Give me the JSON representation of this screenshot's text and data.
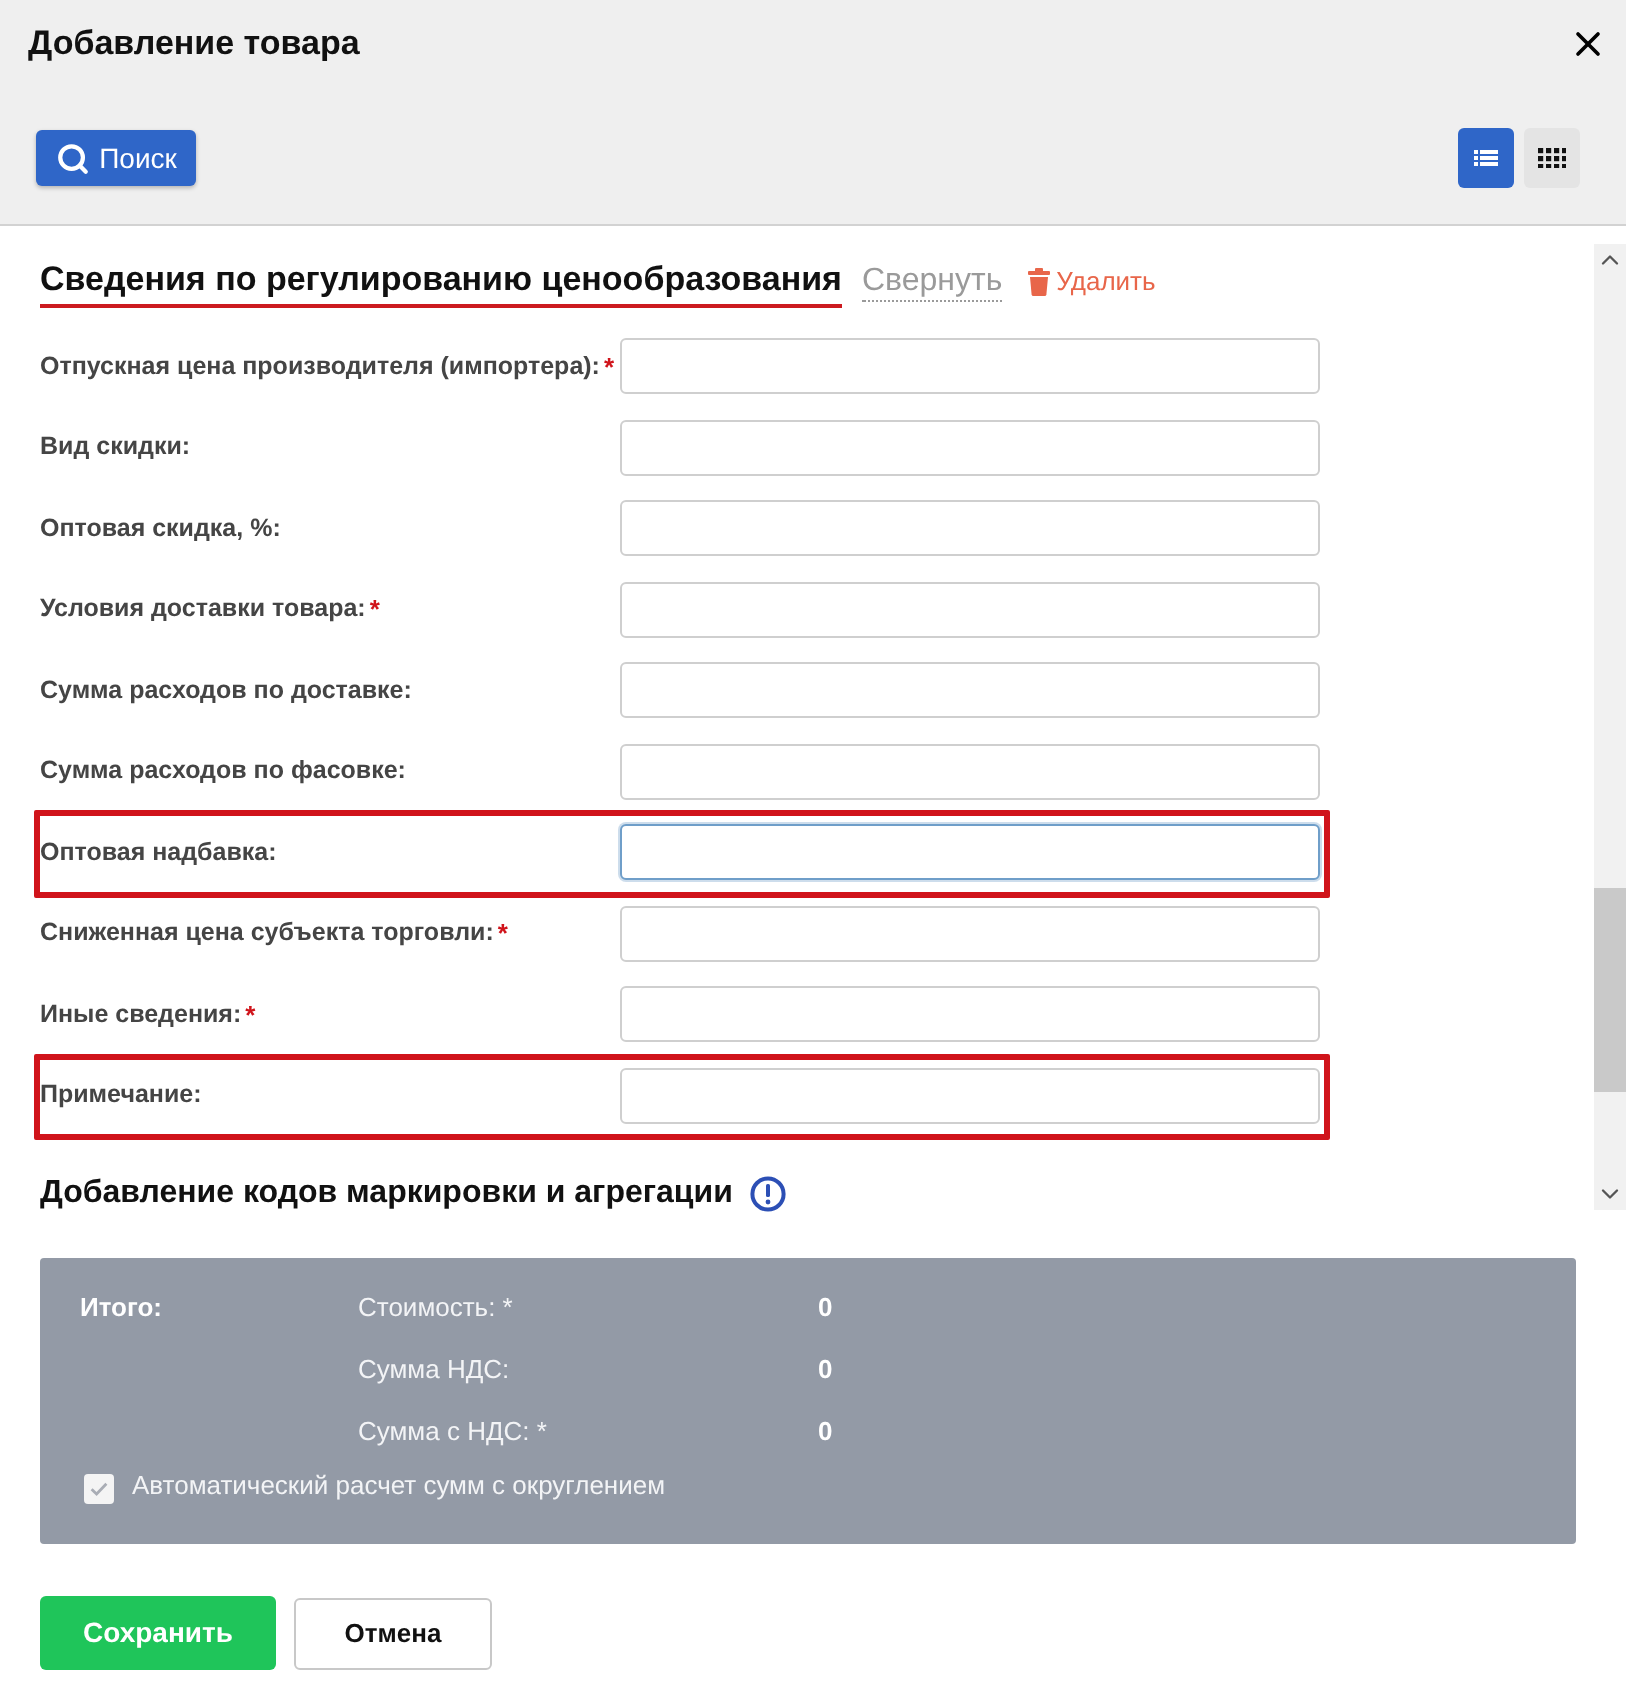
{
  "window": {
    "title": "Добавление товара"
  },
  "toolbar": {
    "search_button": "Поиск",
    "view_modes": [
      {
        "kind": "list",
        "selected": true
      },
      {
        "kind": "grid",
        "selected": false
      }
    ]
  },
  "section": {
    "title": "Сведения по регулированию ценообразования",
    "collapse_link": "Свернуть",
    "delete_link": "Удалить",
    "fields": [
      {
        "label": "Отпускная цена производителя (импортера):",
        "required_mark": "*",
        "focused": false,
        "highlighted": false
      },
      {
        "label": "Вид скидки:",
        "focused": false,
        "highlighted": false
      },
      {
        "label": "Оптовая скидка, %:",
        "focused": false,
        "highlighted": false
      },
      {
        "label": "Условия доставки товара:",
        "required_mark": "*",
        "focused": false,
        "highlighted": false
      },
      {
        "label": "Сумма расходов по доставке:",
        "focused": false,
        "highlighted": false
      },
      {
        "label": "Сумма расходов по фасовке:",
        "focused": false,
        "highlighted": false
      },
      {
        "label": "Оптовая надбавка:",
        "focused": true,
        "highlighted": true
      },
      {
        "label": "Сниженная цена субъекта торговли:",
        "required_mark": "*",
        "focused": false,
        "highlighted": false
      },
      {
        "label": "Иные сведения:",
        "required_mark": "*",
        "focused": false,
        "highlighted": false
      },
      {
        "label": "Примечание:",
        "focused": false,
        "highlighted": true
      }
    ]
  },
  "next_section": {
    "title": "Добавление кодов маркировки и агрегации"
  },
  "totals": {
    "title": "Итого:",
    "rows": [
      {
        "label": "Стоимость: *",
        "value": "0"
      },
      {
        "label": "Сумма НДС:",
        "value": "0"
      },
      {
        "label": "Сумма с НДС: *",
        "value": "0"
      }
    ],
    "auto_calc": {
      "label": "Автоматический расчет сумм с округлением",
      "checked": true
    }
  },
  "buttons": [
    {
      "kind": "primary",
      "label": "Сохранить"
    },
    {
      "kind": "secondary",
      "label": "Отмена"
    }
  ]
}
